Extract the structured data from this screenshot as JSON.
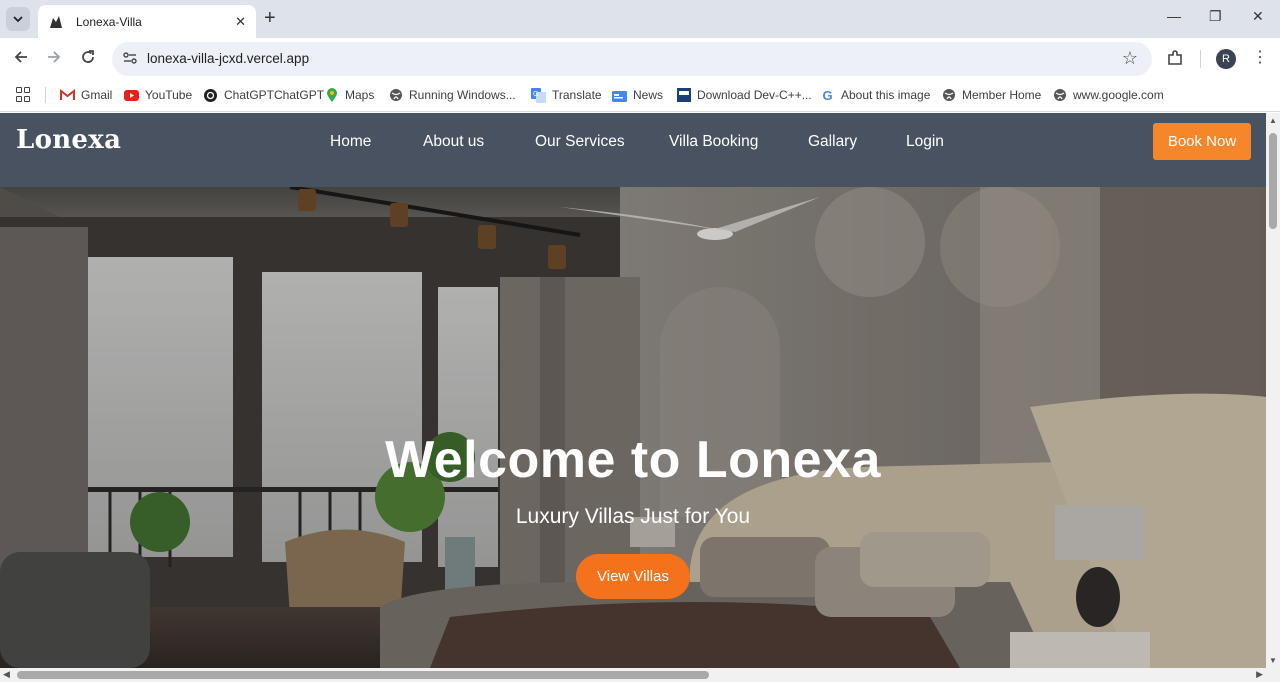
{
  "browser": {
    "tab_title": "Lonexa-Villa",
    "new_tab_symbol": "+",
    "url": "lonexa-villa-jcxd.vercel.app",
    "avatar_letter": "R",
    "window_controls": {
      "minimize": "—",
      "restore": "❐",
      "close": "✕"
    },
    "bookmarks": [
      {
        "label": "Gmail",
        "icon": "gmail-icon"
      },
      {
        "label": "YouTube",
        "icon": "youtube-icon"
      },
      {
        "label": "ChatGPTChatGPT",
        "icon": "chatgpt-icon"
      },
      {
        "label": "Maps",
        "icon": "maps-icon"
      },
      {
        "label": "Running Windows...",
        "icon": "globe-icon"
      },
      {
        "label": "Translate",
        "icon": "translate-icon"
      },
      {
        "label": "News",
        "icon": "news-icon"
      },
      {
        "label": "Download Dev-C++...",
        "icon": "devcpp-icon"
      },
      {
        "label": "About this image",
        "icon": "google-icon"
      },
      {
        "label": "Member Home",
        "icon": "globe-icon"
      },
      {
        "label": "www.google.com",
        "icon": "globe-icon"
      }
    ]
  },
  "site": {
    "logo": "Lonexa",
    "nav": [
      "Home",
      "About us",
      "Our Services",
      "Villa Booking",
      "Gallary",
      "Login"
    ],
    "book_now": "Book Now",
    "hero": {
      "title": "Welcome to Lonexa",
      "subtitle": "Luxury Villas Just for You",
      "cta": "View Villas"
    },
    "colors": {
      "nav_bg": "#485261",
      "accent": "#f5872a",
      "cta": "#f5721c"
    }
  }
}
